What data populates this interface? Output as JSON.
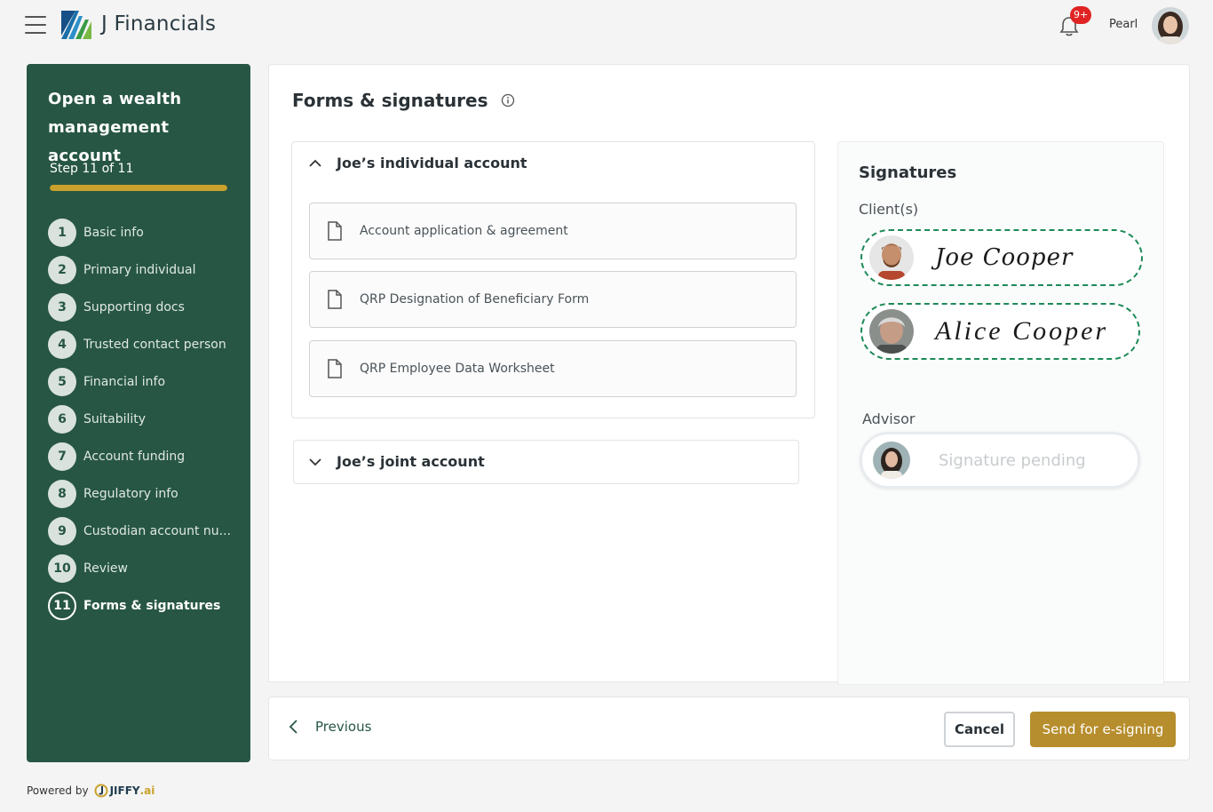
{
  "header": {
    "brand": "J Financials",
    "notification_badge": "9+",
    "user_name": "Pearl"
  },
  "sidebar": {
    "title": "Open a wealth management  account",
    "step_text": "Step 11 of 11",
    "progress": 1.0,
    "items": [
      {
        "num": "1",
        "label": "Basic info"
      },
      {
        "num": "2",
        "label": "Primary individual"
      },
      {
        "num": "3",
        "label": "Supporting docs"
      },
      {
        "num": "4",
        "label": "Trusted contact person"
      },
      {
        "num": "5",
        "label": "Financial info"
      },
      {
        "num": "6",
        "label": "Suitability"
      },
      {
        "num": "7",
        "label": "Account funding"
      },
      {
        "num": "8",
        "label": "Regulatory info"
      },
      {
        "num": "9",
        "label": "Custodian account nu..."
      },
      {
        "num": "10",
        "label": "Review"
      },
      {
        "num": "11",
        "label": "Forms & signatures"
      }
    ],
    "active_step": 11
  },
  "powered_by": {
    "label": "Powered by",
    "brand": "JIFFY",
    "brand_suffix": ".ai"
  },
  "main": {
    "title": "Forms & signatures",
    "accounts": [
      {
        "title": "Joe’s individual account",
        "expanded": true,
        "documents": [
          "Account application & agreement",
          "QRP Designation of Beneficiary Form",
          "QRP Employee Data Worksheet"
        ]
      },
      {
        "title": "Joe’s joint account",
        "expanded": false
      }
    ]
  },
  "signatures": {
    "title": "Signatures",
    "clients_label": "Client(s)",
    "clients": [
      {
        "signature": "Joe Cooper"
      },
      {
        "signature": "Alice Cooper"
      }
    ],
    "advisor_label": "Advisor",
    "advisor_status": "Signature pending"
  },
  "footer": {
    "previous_label": "Previous",
    "cancel_label": "Cancel",
    "send_label": "Send for e-signing"
  },
  "colors": {
    "sidebar_bg": "#275644",
    "accent_gold": "#b78e2d",
    "signed_border": "#1d8a58",
    "badge_red": "#e02424"
  }
}
